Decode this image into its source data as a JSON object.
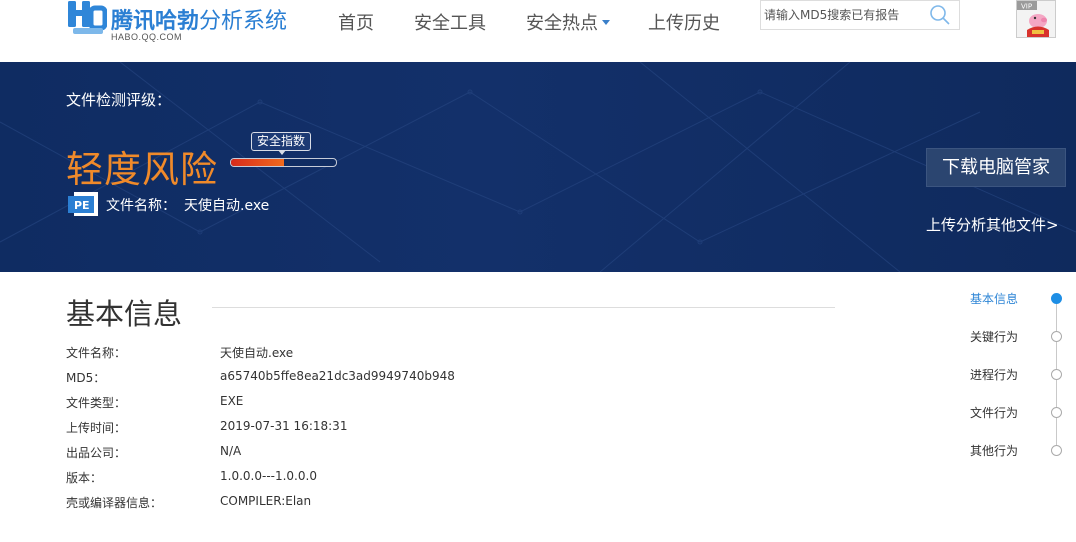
{
  "header": {
    "logo_title_bold": "腾讯哈勃",
    "logo_title_light": "分析系统",
    "logo_subtitle": "HABO.QQ.COM",
    "nav": [
      {
        "label": "首页",
        "dropdown": false
      },
      {
        "label": "安全工具",
        "dropdown": false
      },
      {
        "label": "安全热点",
        "dropdown": true
      },
      {
        "label": "上传历史",
        "dropdown": false
      }
    ],
    "search_placeholder": "请输入MD5搜索已有报告",
    "avatar_badge": "VIP"
  },
  "banner": {
    "grade_label": "文件检测评级：",
    "risk_level": "轻度风险",
    "risk_color": "#f08a2a",
    "safety_badge": "安全指数",
    "safety_level": 0.5,
    "file_icon": "PE",
    "file_name_label": "文件名称：",
    "file_name": "天使自动.exe",
    "download_button": "下载电脑管家",
    "upload_link": "上传分析其他文件>"
  },
  "basic_info": {
    "title": "基本信息",
    "rows": [
      {
        "key": "文件名称：",
        "value": "天使自动.exe"
      },
      {
        "key": "MD5：",
        "value": "a65740b5ffe8ea21dc3ad9949740b948"
      },
      {
        "key": "文件类型：",
        "value": "EXE"
      },
      {
        "key": "上传时间：",
        "value": "2019-07-31 16:18:31"
      },
      {
        "key": "出品公司：",
        "value": "N/A"
      },
      {
        "key": "版本：",
        "value": "1.0.0.0---1.0.0.0"
      },
      {
        "key": "壳或编译器信息：",
        "value": "COMPILER:Elan"
      }
    ]
  },
  "side_nav": {
    "items": [
      {
        "label": "基本信息",
        "active": true
      },
      {
        "label": "关键行为",
        "active": false
      },
      {
        "label": "进程行为",
        "active": false
      },
      {
        "label": "文件行为",
        "active": false
      },
      {
        "label": "其他行为",
        "active": false
      }
    ]
  },
  "colors": {
    "brand_blue": "#2b7fd3",
    "banner_bg": "#13306a",
    "risk_orange": "#f08a2a",
    "active_blue": "#1e8ee5"
  }
}
